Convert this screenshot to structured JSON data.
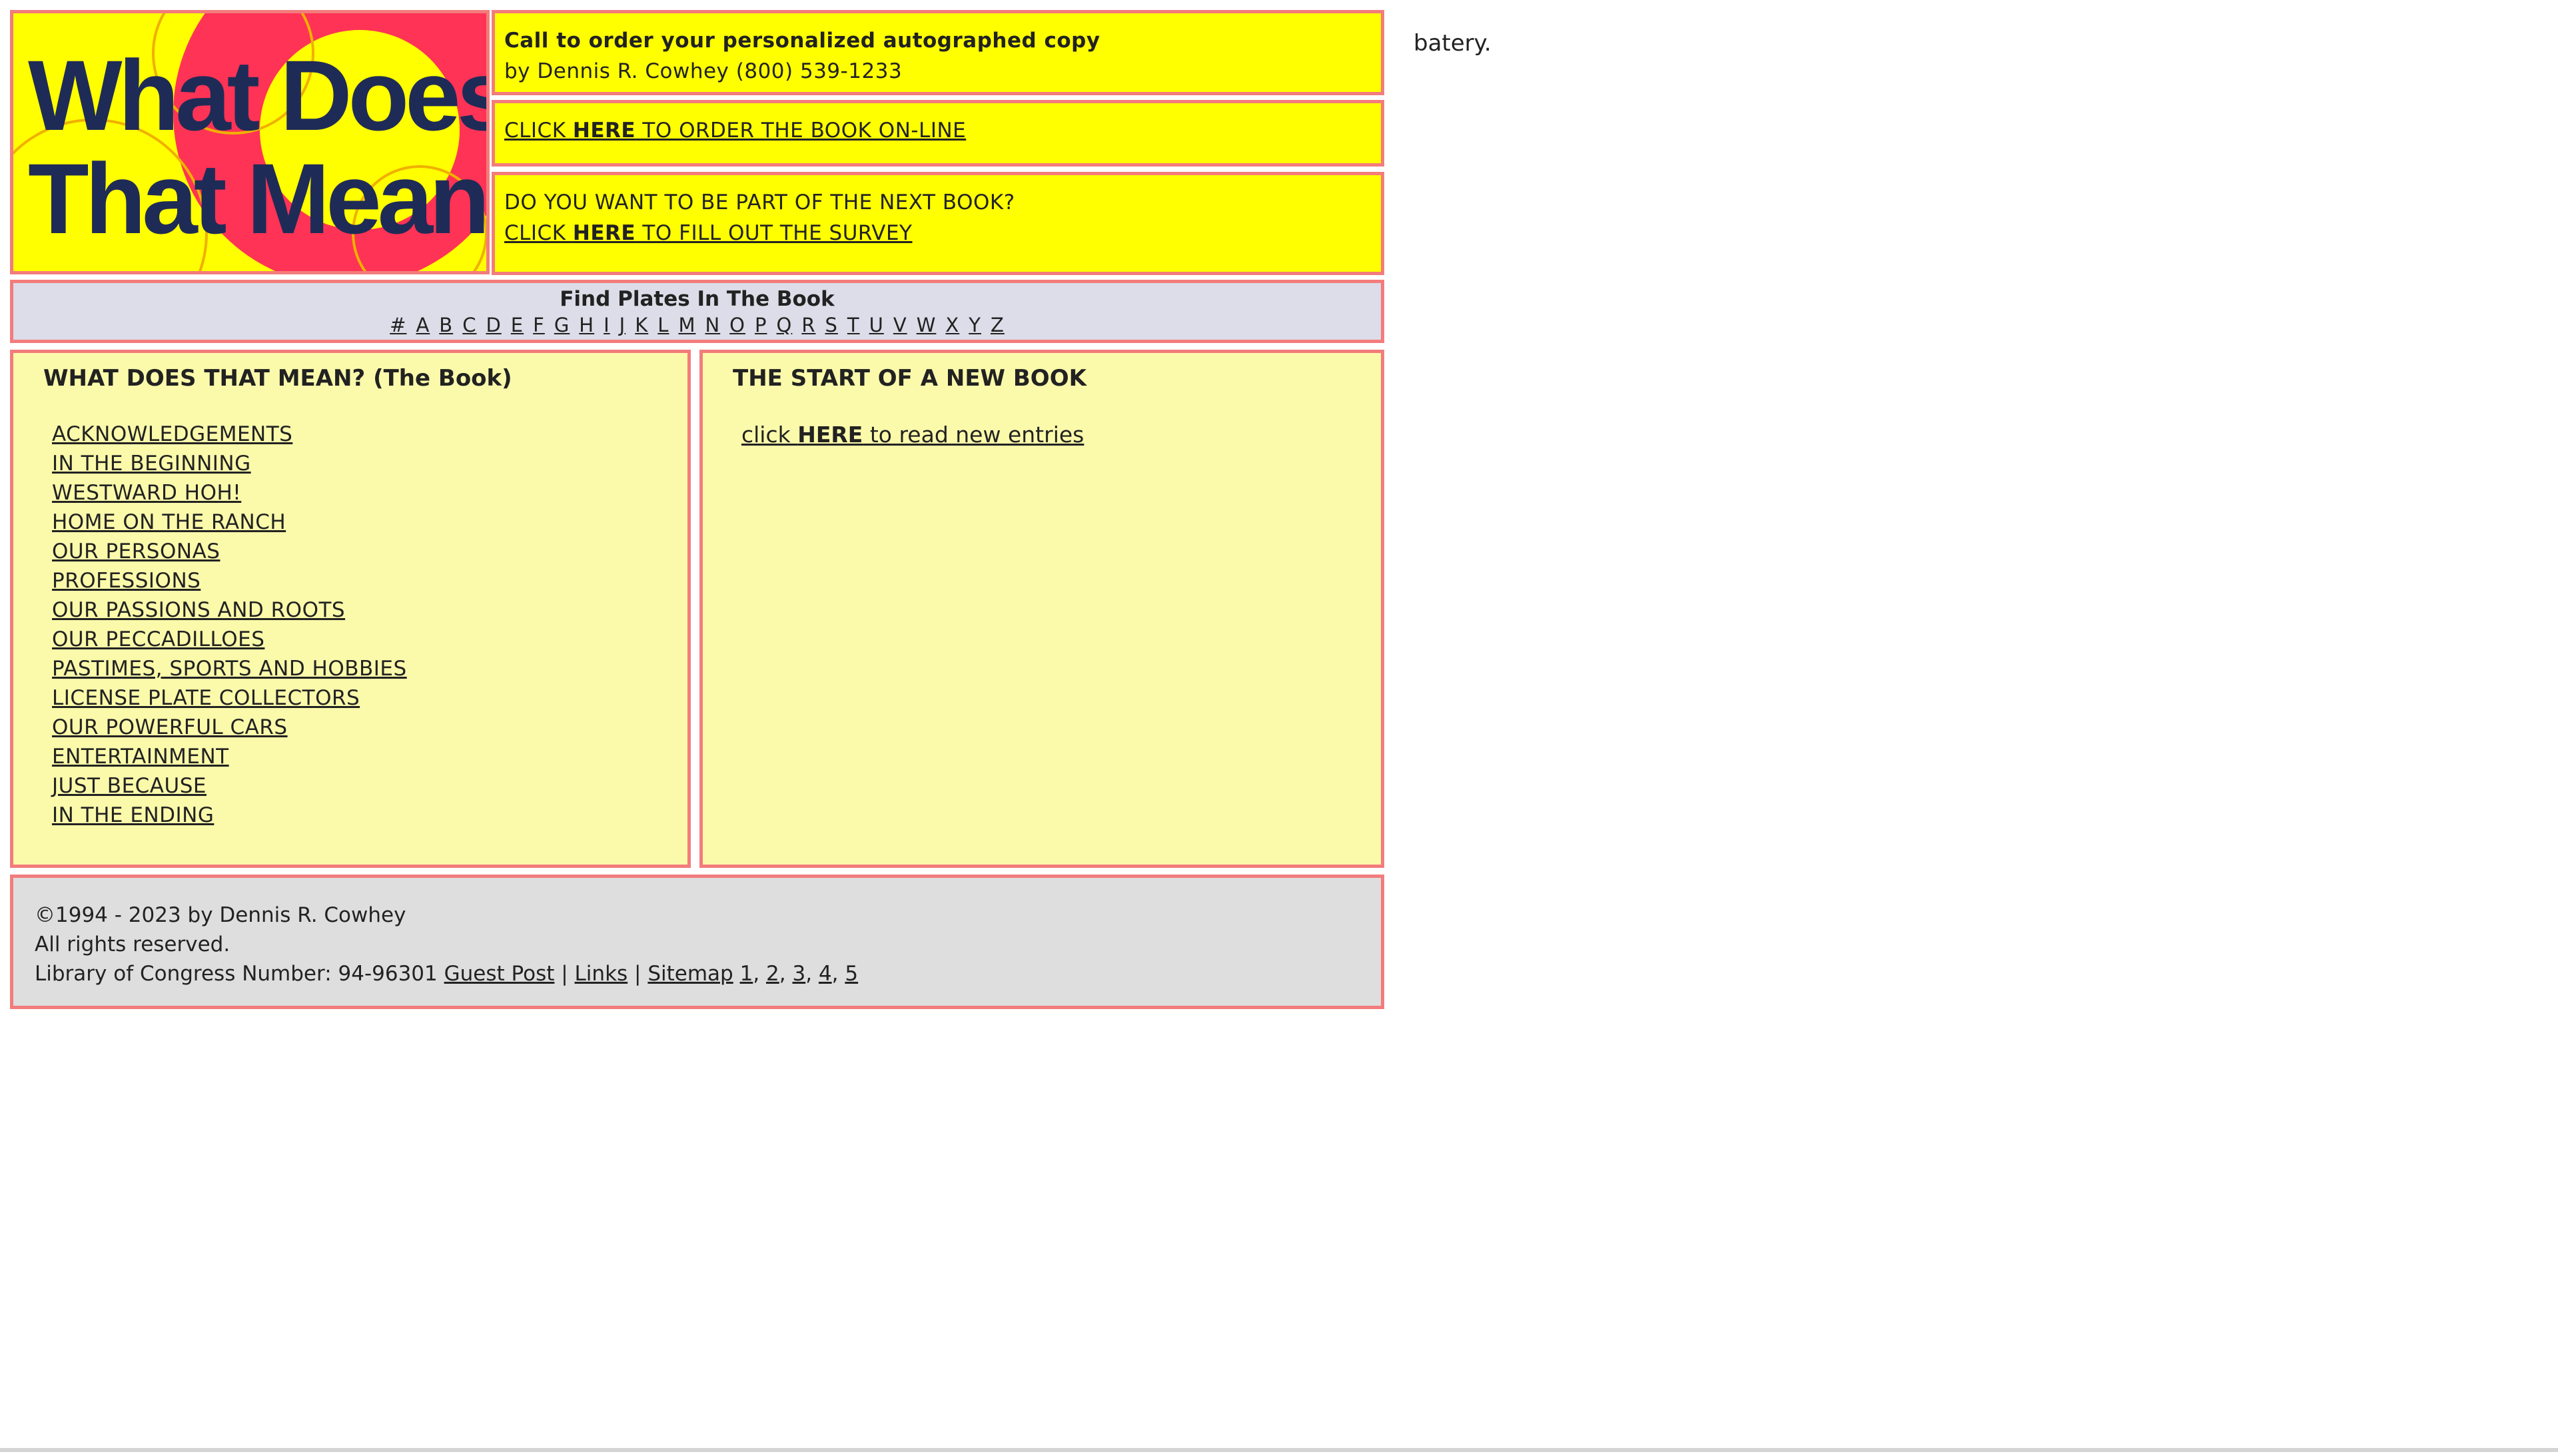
{
  "logo": {
    "line1": "What Does",
    "line2": "That Mean",
    "colors": {
      "background": "#ffff00",
      "accent": "#ff3355",
      "text": "#1f2b57"
    }
  },
  "header": {
    "call_text": "Call to order your personalized autographed copy",
    "call_sub": "by Dennis R. Cowhey (800) 539-1233",
    "order_pre": "CLICK ",
    "order_here": "HERE",
    "order_post": " TO ORDER THE BOOK ON-LINE",
    "survey_question": "DO YOU WANT TO BE PART OF THE NEXT BOOK?",
    "survey_pre": "CLICK ",
    "survey_here": "HERE",
    "survey_post": " TO FILL OUT THE SURVEY"
  },
  "plates": {
    "title": "Find Plates In The Book",
    "letters": [
      "#",
      "A",
      "B",
      "C",
      "D",
      "E",
      "F",
      "G",
      "H",
      "I",
      "J",
      "K",
      "L",
      "M",
      "N",
      "O",
      "P",
      "Q",
      "R",
      "S",
      "T",
      "U",
      "V",
      "W",
      "X",
      "Y",
      "Z"
    ]
  },
  "book": {
    "title": "WHAT DOES THAT MEAN? (The Book)",
    "items": [
      "ACKNOWLEDGEMENTS",
      "IN THE BEGINNING",
      "WESTWARD HOH!",
      "HOME ON THE RANCH",
      "OUR PERSONAS",
      "PROFESSIONS",
      "OUR PASSIONS AND ROOTS",
      "OUR PECCADILLOES",
      "PASTIMES, SPORTS AND HOBBIES",
      "LICENSE PLATE COLLECTORS",
      "OUR POWERFUL CARS",
      "ENTERTAINMENT",
      "JUST BECAUSE",
      "IN THE ENDING"
    ]
  },
  "newbook": {
    "title": "THE START OF A NEW BOOK",
    "link_pre": "click ",
    "link_here": "HERE",
    "link_post": " to read new entries"
  },
  "footer": {
    "copyright": "©1994 - 2023 by Dennis R. Cowhey",
    "rights": "All rights reserved.",
    "loc": "Library of Congress Number: 94-96301 ",
    "guest_post": "Guest Post",
    "sep": " | ",
    "links": "Links",
    "sitemap": "Sitemap",
    "pages": [
      "1",
      "2",
      "3",
      "4",
      "5"
    ]
  },
  "sidenote": "batery."
}
